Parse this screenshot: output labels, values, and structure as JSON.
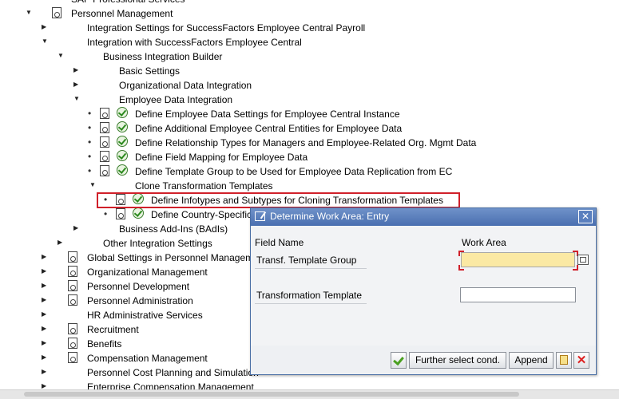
{
  "tree": [
    {
      "label": "SAP Professional Services",
      "level": 0,
      "expand": "none",
      "icon": "none"
    },
    {
      "label": "Personnel Management",
      "level": 1,
      "expand": "open",
      "icon": "doc"
    },
    {
      "label": "Integration Settings for SuccessFactors Employee Central Payroll",
      "level": 2,
      "expand": "closed",
      "icon": "none"
    },
    {
      "label": "Integration with SuccessFactors Employee Central",
      "level": 2,
      "expand": "open",
      "icon": "none"
    },
    {
      "label": "Business Integration Builder",
      "level": 3,
      "expand": "open",
      "icon": "none"
    },
    {
      "label": "Basic Settings",
      "level": 4,
      "expand": "closed",
      "icon": "none"
    },
    {
      "label": "Organizational Data Integration",
      "level": 4,
      "expand": "closed",
      "icon": "none"
    },
    {
      "label": "Employee Data Integration",
      "level": 4,
      "expand": "open",
      "icon": "none"
    },
    {
      "label": "Define Employee Data Settings for Employee Central Instance",
      "level": 5,
      "expand": "bullet",
      "icon": "activity"
    },
    {
      "label": "Define Additional Employee Central Entities for Employee Data",
      "level": 5,
      "expand": "bullet",
      "icon": "activity"
    },
    {
      "label": "Define Relationship Types for Managers and Employee-Related Org. Mgmt Data",
      "level": 5,
      "expand": "bullet",
      "icon": "activity"
    },
    {
      "label": "Define Field Mapping for Employee Data",
      "level": 5,
      "expand": "bullet",
      "icon": "activity"
    },
    {
      "label": "Define Template Group to be Used for Employee Data Replication from EC",
      "level": 5,
      "expand": "bullet",
      "icon": "activity"
    },
    {
      "label": "Clone Transformation Templates",
      "level": 5,
      "expand": "open",
      "icon": "none"
    },
    {
      "label": "Define Infotypes and Subtypes for Cloning Transformation Templates",
      "level": 6,
      "expand": "bullet",
      "icon": "activity",
      "highlighted": true
    },
    {
      "label": "Define Country-Specific",
      "level": 6,
      "expand": "bullet",
      "icon": "activity"
    },
    {
      "label": "Business Add-Ins (BAdIs)",
      "level": 4,
      "expand": "closed",
      "icon": "none"
    },
    {
      "label": "Other Integration Settings",
      "level": 3,
      "expand": "closed",
      "icon": "none"
    },
    {
      "label": "Global Settings in Personnel Managem",
      "level": 2,
      "expand": "closed",
      "icon": "doc"
    },
    {
      "label": "Organizational Management",
      "level": 2,
      "expand": "closed",
      "icon": "doc"
    },
    {
      "label": "Personnel Development",
      "level": 2,
      "expand": "closed",
      "icon": "doc"
    },
    {
      "label": "Personnel Administration",
      "level": 2,
      "expand": "closed",
      "icon": "doc"
    },
    {
      "label": "HR Administrative Services",
      "level": 2,
      "expand": "closed",
      "icon": "none"
    },
    {
      "label": "Recruitment",
      "level": 2,
      "expand": "closed",
      "icon": "doc"
    },
    {
      "label": "Benefits",
      "level": 2,
      "expand": "closed",
      "icon": "doc"
    },
    {
      "label": "Compensation Management",
      "level": 2,
      "expand": "closed",
      "icon": "doc"
    },
    {
      "label": "Personnel Cost Planning and Simulation",
      "level": 2,
      "expand": "closed",
      "icon": "none"
    },
    {
      "label": "Enterprise Compensation Management",
      "level": 2,
      "expand": "closed",
      "icon": "none"
    }
  ],
  "dialog": {
    "title": "Determine Work Area: Entry",
    "col_field_name": "Field Name",
    "col_work_area": "Work Area",
    "field1_label": "Transf. Template Group",
    "field1_value": "",
    "field2_label": "Transformation Template",
    "field2_value": "",
    "btn_further": "Further select cond.",
    "btn_append": "Append"
  },
  "icons": {
    "tree_doc": "img-icon",
    "tree_activity": "execute-clock-icon",
    "dialog_title": "work-area-icon",
    "close": "close-icon",
    "ok": "checkmark-icon",
    "copy": "copy-icon",
    "cancel": "cancel-icon",
    "match": "possible-entries-icon"
  },
  "colors": {
    "highlight_border": "#d0202a",
    "dialog_title_bg": "#4a6fb0",
    "required_field": "#fbe9a4"
  }
}
